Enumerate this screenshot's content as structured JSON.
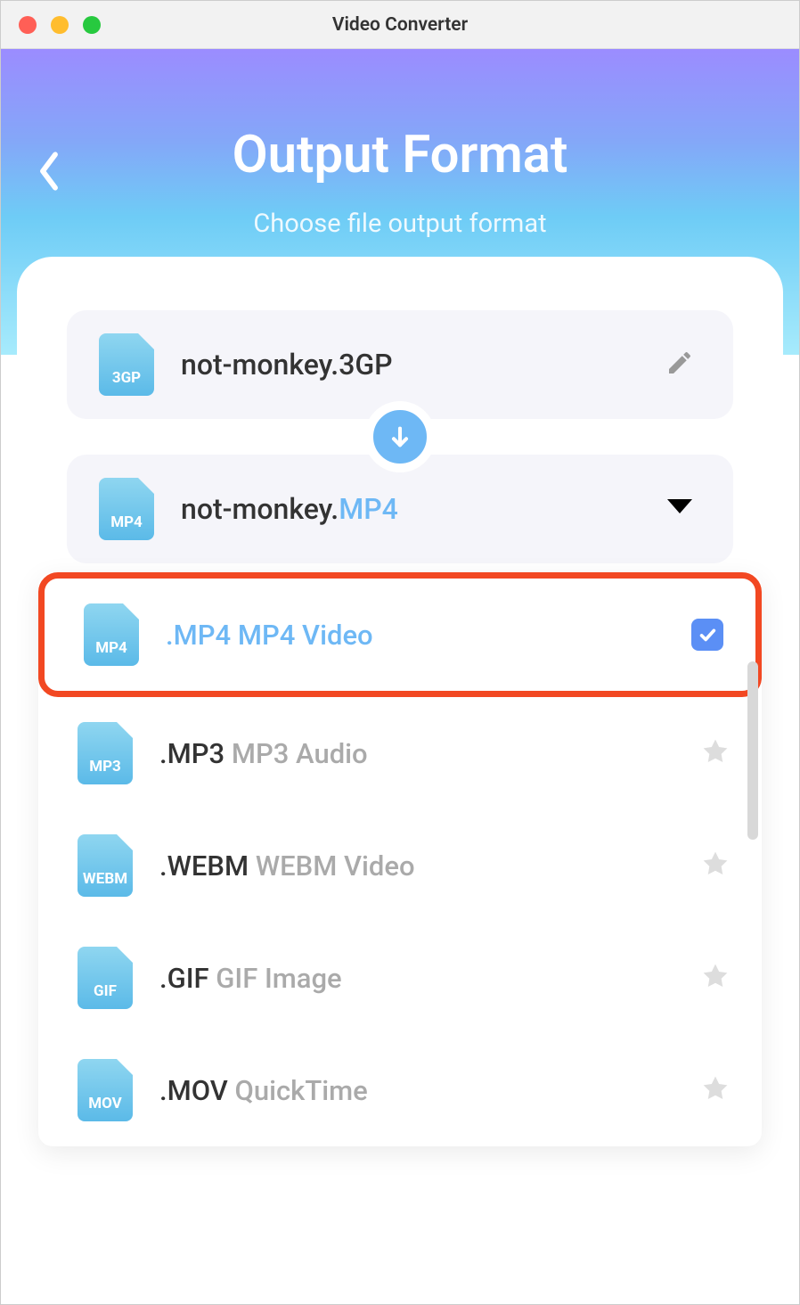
{
  "window": {
    "title": "Video Converter"
  },
  "header": {
    "title": "Output Format",
    "subtitle": "Choose file output format"
  },
  "source": {
    "icon_label": "3GP",
    "filename": "not-monkey.3GP"
  },
  "target": {
    "icon_label": "MP4",
    "basename": "not-monkey.",
    "extension": "MP4"
  },
  "formats": [
    {
      "icon": "MP4",
      "ext": ".MP4",
      "desc": "MP4 Video",
      "selected": true,
      "highlighted": true
    },
    {
      "icon": "MP3",
      "ext": ".MP3",
      "desc": "MP3 Audio",
      "selected": false,
      "highlighted": false
    },
    {
      "icon": "WEBM",
      "ext": ".WEBM",
      "desc": "WEBM Video",
      "selected": false,
      "highlighted": false
    },
    {
      "icon": "GIF",
      "ext": ".GIF",
      "desc": "GIF Image",
      "selected": false,
      "highlighted": false
    },
    {
      "icon": "MOV",
      "ext": ".MOV",
      "desc": "QuickTime",
      "selected": false,
      "highlighted": false
    }
  ]
}
